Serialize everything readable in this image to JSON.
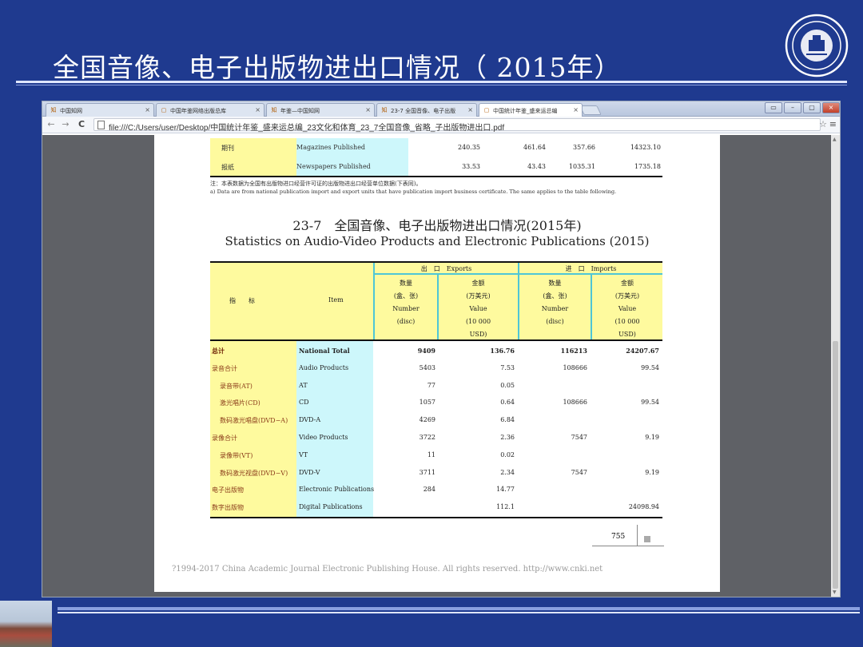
{
  "slide": {
    "title": "全国音像、电子出版物进出口情况（ 2015年）"
  },
  "browser": {
    "tabs": [
      {
        "label": "中国知网",
        "icon": "知"
      },
      {
        "label": "中国年鉴网络出版总库",
        "icon": "▢"
      },
      {
        "label": "年鉴—中国知网",
        "icon": "知"
      },
      {
        "label": "23-7 全国音像、电子出版",
        "icon": "知"
      },
      {
        "label": "中国统计年鉴_盛来运总编",
        "icon": "▢"
      }
    ],
    "address": "file:///C:/Users/user/Desktop/中国统计年鉴_盛来运总编_23文化和体育_23_7全国音像_省略_子出版物进出口.pdf"
  },
  "pdf": {
    "prev_rows": [
      {
        "zh": "期刊",
        "en": "Magazines Published",
        "v": [
          "240.35",
          "461.64",
          "357.66",
          "14323.10"
        ]
      },
      {
        "zh": "报纸",
        "en": "Newspapers Published",
        "v": [
          "33.53",
          "43.43",
          "1035.31",
          "1735.18"
        ]
      }
    ],
    "note_zh": "注：本表数据为全国有出版物进口经营许可证的出版物进出口经营单位数据(下表同)。",
    "note_en": "a) Data are from national publication import and export units that have publication import business certificate. The same applies to the table following.",
    "table_title_zh": "23-7　全国音像、电子出版物进出口情况(2015年)",
    "table_title_en": "Statistics on Audio-Video Products and Electronic Publications (2015)",
    "headers": {
      "indicator_zh": "指　　标",
      "item_en": "Item",
      "exports": "出　口　Exports",
      "imports": "进　口　Imports",
      "number_zh": "数量",
      "number_unit_zh": "(盒、张)",
      "number_en": "Number",
      "number_unit_en": "(disc)",
      "value_zh": "金额",
      "value_unit_zh": "(万美元)",
      "value_en": "Value",
      "value_unit_en": "(10 000",
      "value_unit_en2": "USD)"
    },
    "rows": [
      {
        "zh": "总计",
        "en": "National Total",
        "v": [
          "9409",
          "136.76",
          "116213",
          "24207.67"
        ],
        "bold": true,
        "indent": false
      },
      {
        "zh": "录音合计",
        "en": "Audio Products",
        "v": [
          "5403",
          "7.53",
          "108666",
          "99.54"
        ],
        "bold": false,
        "indent": false
      },
      {
        "zh": "录音带(AT)",
        "en": "AT",
        "v": [
          "77",
          "0.05",
          "",
          ""
        ],
        "bold": false,
        "indent": true
      },
      {
        "zh": "激光唱片(CD)",
        "en": "CD",
        "v": [
          "1057",
          "0.64",
          "108666",
          "99.54"
        ],
        "bold": false,
        "indent": true
      },
      {
        "zh": "数码激光唱盘(DVD−A)",
        "en": "DVD-A",
        "v": [
          "4269",
          "6.84",
          "",
          ""
        ],
        "bold": false,
        "indent": true
      },
      {
        "zh": "录像合计",
        "en": "Video Products",
        "v": [
          "3722",
          "2.36",
          "7547",
          "9.19"
        ],
        "bold": false,
        "indent": false
      },
      {
        "zh": "录像带(VT)",
        "en": "VT",
        "v": [
          "11",
          "0.02",
          "",
          ""
        ],
        "bold": false,
        "indent": true
      },
      {
        "zh": "数码激光视盘(DVD−V)",
        "en": "DVD-V",
        "v": [
          "3711",
          "2.34",
          "7547",
          "9.19"
        ],
        "bold": false,
        "indent": true
      },
      {
        "zh": "电子出版物",
        "en": "Electronic Publications",
        "v": [
          "284",
          "14.77",
          "",
          ""
        ],
        "bold": false,
        "indent": false
      },
      {
        "zh": "数字出版物",
        "en": "Digital Publications",
        "v": [
          "",
          "112.1",
          "",
          "24098.94"
        ],
        "bold": false,
        "indent": false
      }
    ],
    "page_number": "755",
    "footer": "?1994-2017 China Academic Journal Electronic Publishing House. All rights reserved.    http://www.cnki.net"
  }
}
